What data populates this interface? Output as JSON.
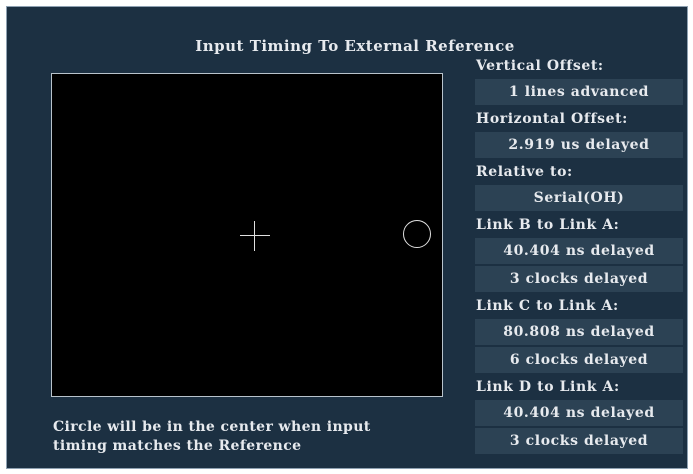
{
  "title": "Input Timing To External Reference",
  "caption": {
    "line1": "Circle will be in the center when input",
    "line2": "timing matches the Reference"
  },
  "measurements": {
    "vertical_offset": {
      "label": "Vertical Offset:",
      "value": "1 lines advanced"
    },
    "horizontal_offset": {
      "label": "Horizontal Offset:",
      "value": "2.919 us delayed"
    },
    "relative_to": {
      "label": "Relative to:",
      "value": "Serial(OH)"
    },
    "link_b": {
      "label": "Link B to Link A:",
      "time": "40.404 ns delayed",
      "clocks": "3 clocks delayed"
    },
    "link_c": {
      "label": "Link C to Link A:",
      "time": "80.808 ns delayed",
      "clocks": "6 clocks delayed"
    },
    "link_d": {
      "label": "Link D to Link A:",
      "time": "40.404 ns delayed",
      "clocks": "3 clocks delayed"
    }
  },
  "colors": {
    "panel_background": "#1c3042",
    "value_box_background": "#2c4254",
    "display_background": "#000000",
    "text": "#e7eaee"
  }
}
